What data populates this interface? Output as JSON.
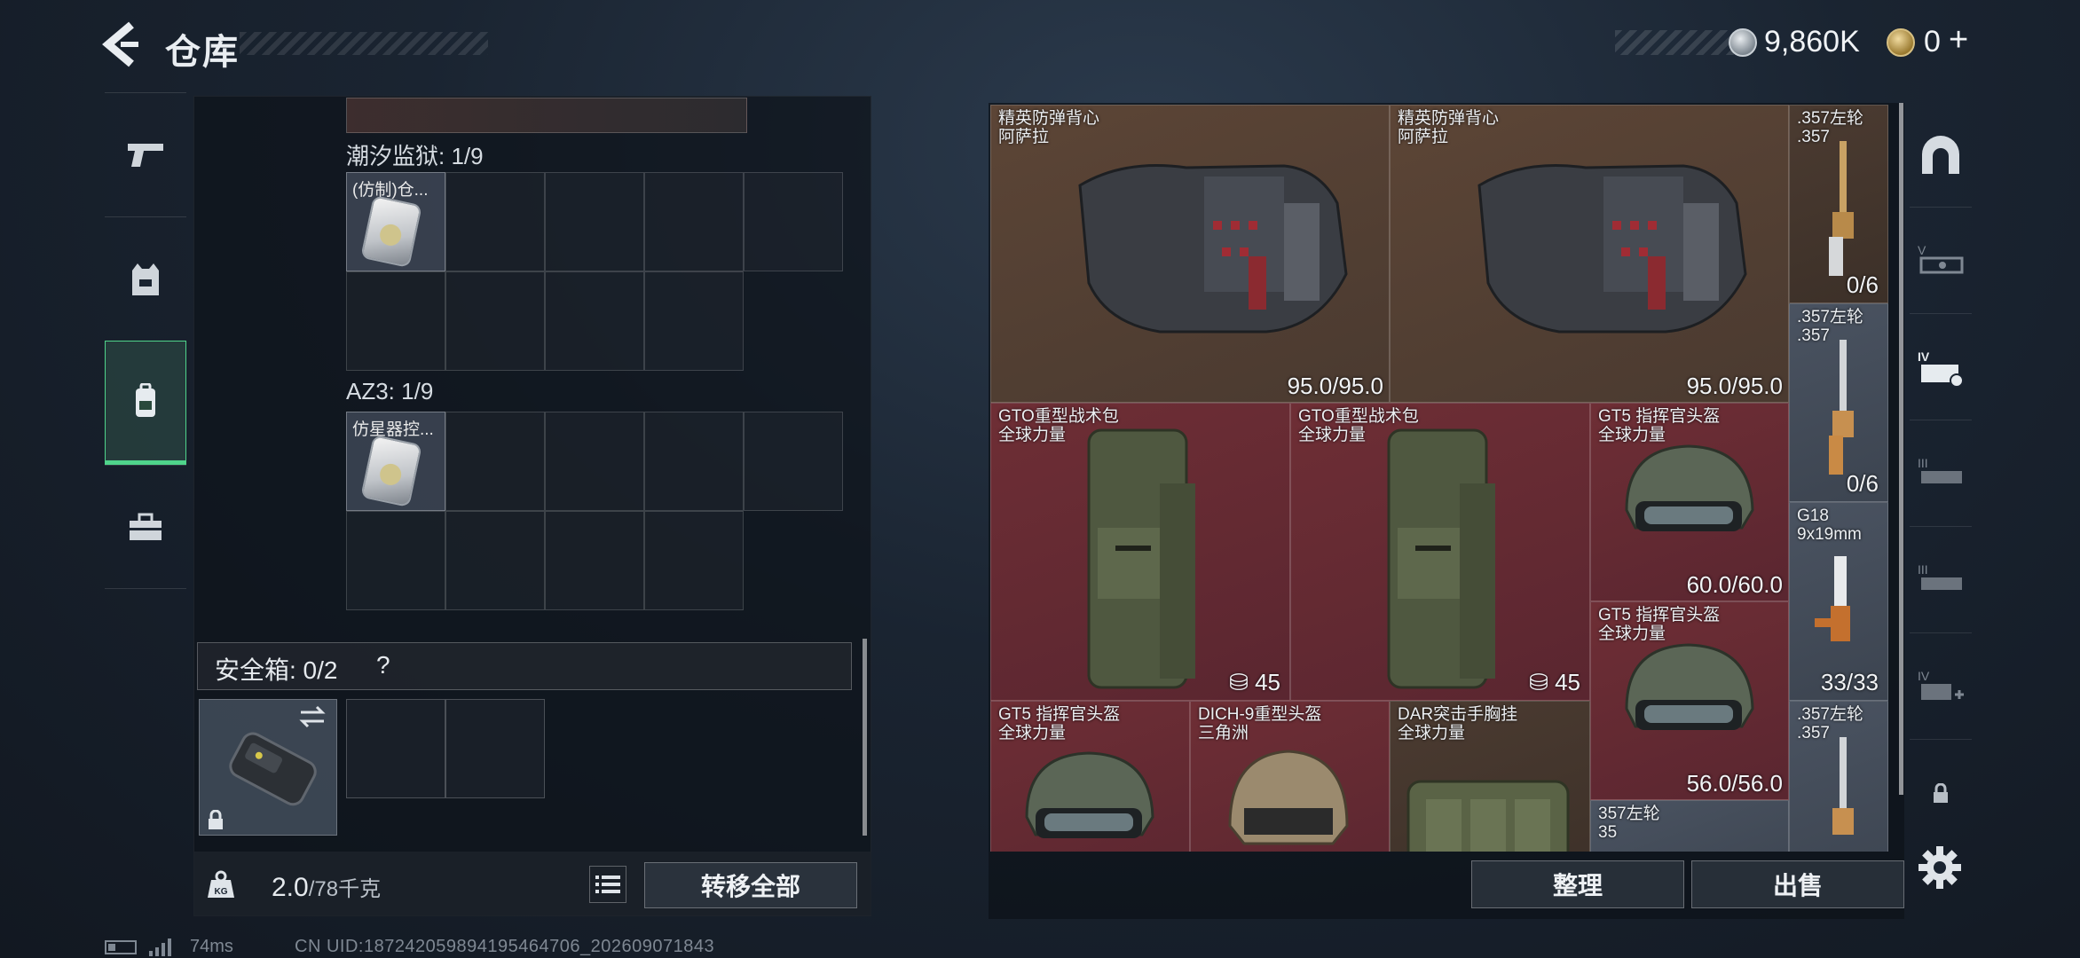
{
  "header": {
    "title": "仓库",
    "currency_silver": "9,860K",
    "currency_gold": "0",
    "gold_plus": "+"
  },
  "left_sidebar": {
    "items": [
      {
        "icon": "pistol-icon"
      },
      {
        "icon": "armor-vest-icon"
      },
      {
        "icon": "backpack-icon",
        "active": true
      },
      {
        "icon": "toolbox-icon"
      }
    ]
  },
  "containers": [
    {
      "label": "潮汐监狱: 1/9",
      "item_label": "(仿制)仓..."
    },
    {
      "label": "AZ3: 1/9",
      "item_label": "仿星器控..."
    }
  ],
  "safe_box": {
    "label": "安全箱: 0/2",
    "help": "?"
  },
  "weight": {
    "current": "2.0",
    "max": "/78",
    "unit": "千克"
  },
  "buttons": {
    "transfer_all": "转移全部",
    "sort": "整理",
    "sell": "出售"
  },
  "stash_items": [
    {
      "name": "精英防弹背心\n阿萨拉",
      "durability": "95.0/95.0"
    },
    {
      "name": "精英防弹背心\n阿萨拉",
      "durability": "95.0/95.0"
    },
    {
      "name": ".357左轮\n.357",
      "ammo": "0/6"
    },
    {
      "name": ".357左轮\n.357",
      "ammo": "0/6"
    },
    {
      "name": "GTO重型战术包\n全球力量",
      "capacity": "45"
    },
    {
      "name": "GTO重型战术包\n全球力量",
      "capacity": "45"
    },
    {
      "name": "GT5 指挥官头盔\n全球力量",
      "durability": "60.0/60.0"
    },
    {
      "name": "G18\n9x19mm",
      "ammo": "33/33"
    },
    {
      "name": "GT5 指挥官头盔\n全球力量",
      "durability": "56.0/56.0"
    },
    {
      "name": ".357左轮\n.357"
    },
    {
      "name": "GT5 指挥官头盔\n全球力量"
    },
    {
      "name": "DICH-9重型头盔\n三角洲"
    },
    {
      "name": "DAR突击手胸挂\n全球力量"
    },
    {
      "name": "357左轮\n35"
    }
  ],
  "right_sidebar": {
    "items": [
      {
        "icon": "arch-icon"
      },
      {
        "icon": "v-gun-icon",
        "tier": "V"
      },
      {
        "icon": "iv-gun-case-icon",
        "tier": "IV"
      },
      {
        "icon": "iii-gun-icon",
        "tier": "III"
      },
      {
        "icon": "iii-gun-alt-icon",
        "tier": "III"
      },
      {
        "icon": "iv-add-icon",
        "tier": "IV"
      },
      {
        "icon": "lock-icon"
      }
    ]
  },
  "footer": {
    "ping": "74ms",
    "uid": "CN UID:18724205989419546470​6_202609071843"
  },
  "colors": {
    "accent_green": "#4fd48b",
    "tile_red": "#6e2e35",
    "tile_brown": "#5c4536"
  }
}
